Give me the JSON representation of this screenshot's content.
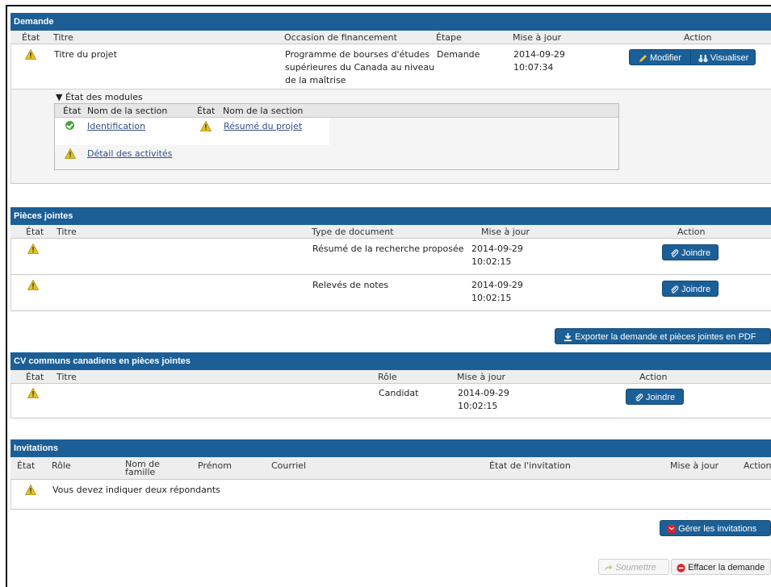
{
  "demande": {
    "title": "Demande",
    "cols": {
      "etat": "État",
      "titre": "Titre",
      "occasion": "Occasion de financement",
      "etape": "Étape",
      "maj": "Mise à jour",
      "action": "Action"
    },
    "row": {
      "titre": "Titre du projet",
      "occasion": [
        "Programme de bourses d'études",
        "supérieures du Canada au niveau",
        "de la maîtrise"
      ],
      "etape": "Demande",
      "date": "2014-09-29",
      "time": "10:07:34",
      "modifier": "Modifier",
      "visualiser": "Visualiser"
    },
    "modules": {
      "toggle": "▼ État des modules",
      "cols": {
        "etat1": "État",
        "nom1": "Nom de la section",
        "etat2": "État",
        "nom2": "Nom de la section"
      },
      "items": [
        "Identification",
        "Résumé du projet",
        "Détail des activités"
      ]
    }
  },
  "pieces": {
    "title": "Pièces jointes",
    "cols": {
      "etat": "État",
      "titre": "Titre",
      "type": "Type de document",
      "maj": "Mise à jour",
      "action": "Action"
    },
    "rows": [
      {
        "type": "Résumé de la recherche proposée",
        "date": "2014-09-29",
        "time": "10:02:15",
        "btn": "Joindre"
      },
      {
        "type": "Relevés de notes",
        "date": "2014-09-29",
        "time": "10:02:15",
        "btn": "Joindre"
      }
    ],
    "export": "Exporter la demande et pièces jointes en PDF"
  },
  "cv": {
    "title": "CV communs canadiens en pièces jointes",
    "cols": {
      "etat": "État",
      "titre": "Titre",
      "role": "Rôle",
      "maj": "Mise à jour",
      "action": "Action"
    },
    "row": {
      "role": "Candidat",
      "date": "2014-09-29",
      "time": "10:02:15",
      "btn": "Joindre"
    }
  },
  "invitations": {
    "title": "Invitations",
    "cols": {
      "etat": "État",
      "role": "Rôle",
      "nom1": "Nom de",
      "nom2": "famille",
      "prenom": "Prénom",
      "courriel": "Courriel",
      "etatinv": "État de l'invitation",
      "maj": "Mise à jour",
      "action": "Action"
    },
    "message": "Vous devez indiquer deux répondants",
    "gerer": "Gérer les invitations"
  },
  "footer": {
    "soumettre": "Soumettre",
    "effacer": "Effacer la demande"
  },
  "colors": {
    "header": "#1b5f96",
    "warning": "#e8c21c",
    "ok": "#4aa33a",
    "danger": "#d9232d"
  }
}
